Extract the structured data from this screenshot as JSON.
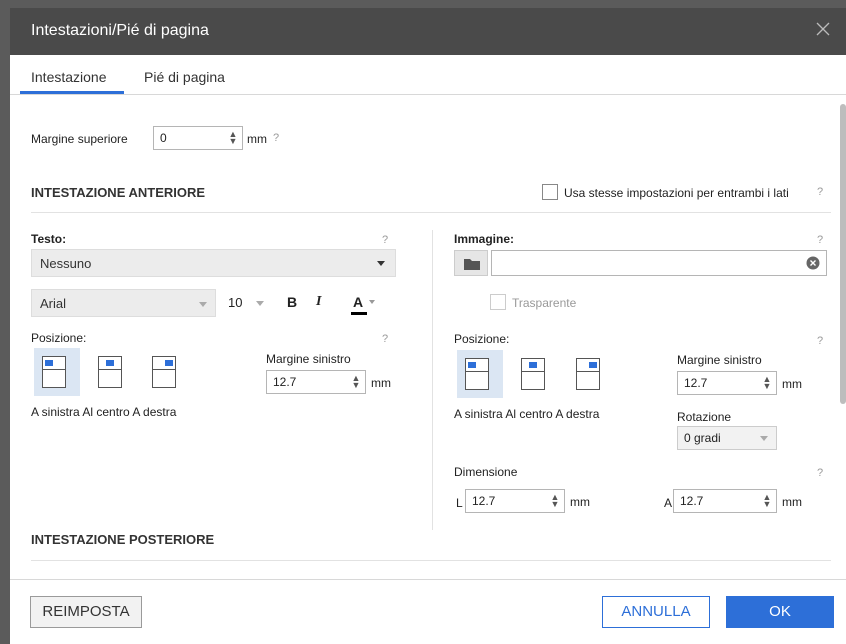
{
  "dialog": {
    "title": "Intestazioni/Pié di pagina",
    "close_icon": "close-icon"
  },
  "tabs": [
    {
      "label": "Intestazione",
      "active": true
    },
    {
      "label": "Pié di pagina",
      "active": false
    }
  ],
  "top_margin": {
    "label": "Margine superiore",
    "value": "0",
    "unit": "mm",
    "help": "?"
  },
  "front_header": {
    "title": "INTESTAZIONE ANTERIORE",
    "same_settings_label": "Usa stesse impostazioni per entrambi i lati",
    "same_settings_checked": false,
    "help": "?",
    "text": {
      "label": "Testo:",
      "help": "?",
      "selected": "Nessuno",
      "font": "Arial",
      "font_size": "10",
      "bold_label": "B",
      "italic_label": "I",
      "color_label": "A",
      "position_label": "Posizione:",
      "position_help": "?",
      "position_options": [
        "A sinistra",
        "Al centro",
        "A destra"
      ],
      "position_options_text": "A sinistra Al centro A destra",
      "selected_position": "A sinistra",
      "left_margin_label": "Margine sinistro",
      "left_margin_value": "12.7",
      "left_margin_unit": "mm"
    },
    "image": {
      "label": "Immagine:",
      "help": "?",
      "path_value": "",
      "transparent_label": "Trasparente",
      "transparent_checked": false,
      "position_label": "Posizione:",
      "position_help": "?",
      "position_options_text": "A sinistra Al centro A destra",
      "selected_position": "A sinistra",
      "left_margin_label": "Margine sinistro",
      "left_margin_value": "12.7",
      "left_margin_unit": "mm",
      "rotation_label": "Rotazione",
      "rotation_value": "0 gradi",
      "dimension_label": "Dimensione",
      "dimension_help": "?",
      "width_prefix": "L",
      "width_value": "12.7",
      "width_unit": "mm",
      "height_prefix": "A",
      "height_value": "12.7",
      "height_unit": "mm"
    }
  },
  "back_header": {
    "title": "INTESTAZIONE POSTERIORE"
  },
  "footer": {
    "reset_label": "REIMPOSTA",
    "cancel_label": "ANNULLA",
    "ok_label": "OK"
  },
  "colors": {
    "accent": "#2d6fd8",
    "titlebar": "#4a4a4a"
  }
}
